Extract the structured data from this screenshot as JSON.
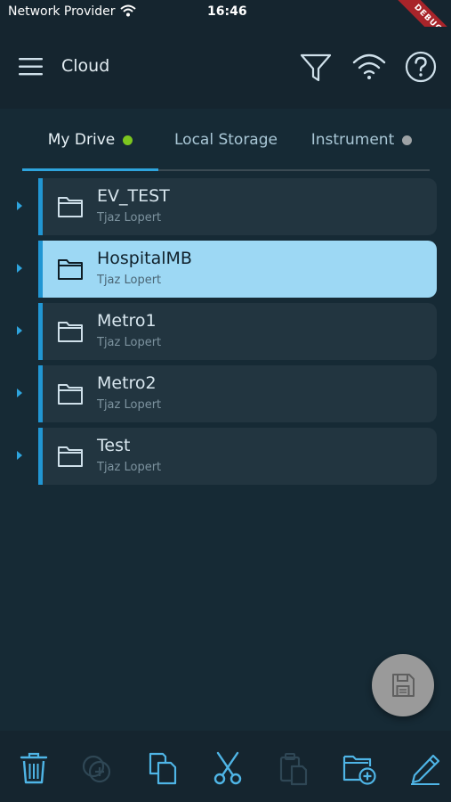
{
  "status": {
    "carrier": "Network Provider",
    "time": "16:46",
    "debug_label": "DEBUG"
  },
  "app_bar": {
    "title": "Cloud",
    "icons": [
      "menu-icon",
      "filter-icon",
      "wifi-icon",
      "help-icon"
    ]
  },
  "tabs": [
    {
      "label": "My Drive",
      "active": true,
      "dot_color": "#7cc61f"
    },
    {
      "label": "Local Storage",
      "active": false
    },
    {
      "label": "Instrument",
      "active": false,
      "dot_color": "#9ea3a6"
    }
  ],
  "files": [
    {
      "name": "EV_TEST",
      "owner": "Tjaz Lopert",
      "selected": false
    },
    {
      "name": "HospitalMB",
      "owner": "Tjaz Lopert",
      "selected": true
    },
    {
      "name": "Metro1",
      "owner": "Tjaz Lopert",
      "selected": false
    },
    {
      "name": "Metro2",
      "owner": "Tjaz Lopert",
      "selected": false
    },
    {
      "name": "Test",
      "owner": "Tjaz Lopert",
      "selected": false
    }
  ],
  "fab": {
    "icon": "save-icon"
  },
  "bottom_bar": {
    "actions": [
      {
        "icon": "trash-icon",
        "enabled": true
      },
      {
        "icon": "add-copy-icon",
        "enabled": false
      },
      {
        "icon": "copy-icon",
        "enabled": true
      },
      {
        "icon": "cut-icon",
        "enabled": true
      },
      {
        "icon": "paste-icon",
        "enabled": false
      },
      {
        "icon": "new-folder-icon",
        "enabled": true
      },
      {
        "icon": "edit-icon",
        "enabled": true
      }
    ]
  },
  "colors": {
    "accent": "#2ea4dd",
    "selected_card": "#9dd8f4",
    "card": "#223540",
    "background": "#162a35"
  }
}
